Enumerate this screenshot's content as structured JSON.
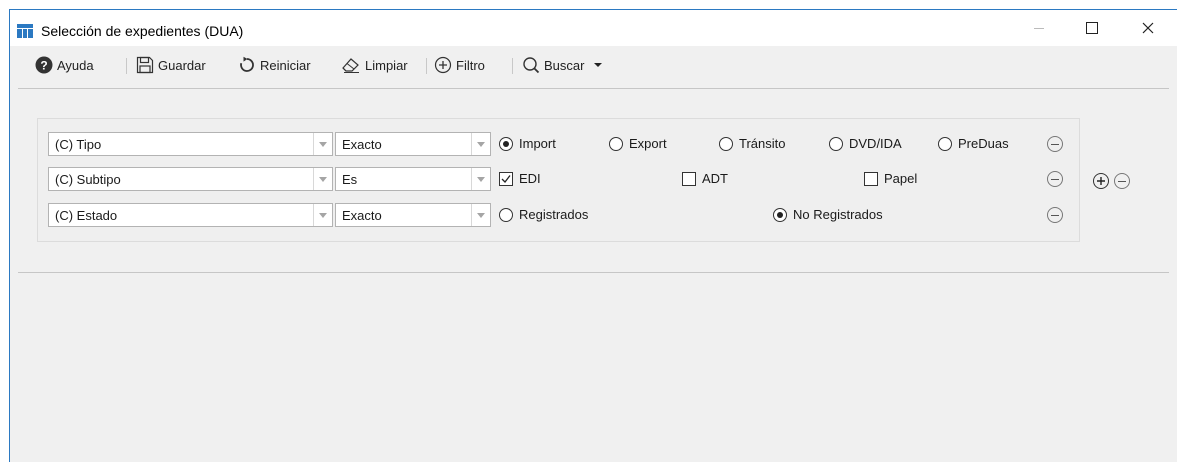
{
  "window": {
    "title": "Selección de expedientes (DUA)"
  },
  "toolbar": {
    "help": "Ayuda",
    "save": "Guardar",
    "reset": "Reiniciar",
    "clear": "Limpiar",
    "filter": "Filtro",
    "search": "Buscar"
  },
  "filters": {
    "row1": {
      "field": "(C) Tipo",
      "operator": "Exacto",
      "options": [
        "Import",
        "Export",
        "Tránsito",
        "DVD/IDA",
        "PreDuas"
      ],
      "selected": "Import"
    },
    "row2": {
      "field": "(C) Subtipo",
      "operator": "Es",
      "checks": [
        "EDI",
        "ADT",
        "Papel"
      ],
      "checked": [
        "EDI"
      ]
    },
    "row3": {
      "field": "(C) Estado",
      "operator": "Exacto",
      "options": [
        "Registrados",
        "No Registrados"
      ],
      "selected": "No Registrados"
    }
  },
  "icons": {
    "app": "app-table-icon",
    "help": "help-circle-icon",
    "save": "floppy-disk-icon",
    "reset": "rotate-icon",
    "clear": "eraser-icon",
    "filter": "plus-circle-icon",
    "search": "magnifier-icon",
    "minimize": "minimize-icon",
    "maximize": "maximize-icon",
    "close": "close-icon"
  },
  "colors": {
    "accent": "#2b79c2",
    "background": "#f0f0f0"
  }
}
